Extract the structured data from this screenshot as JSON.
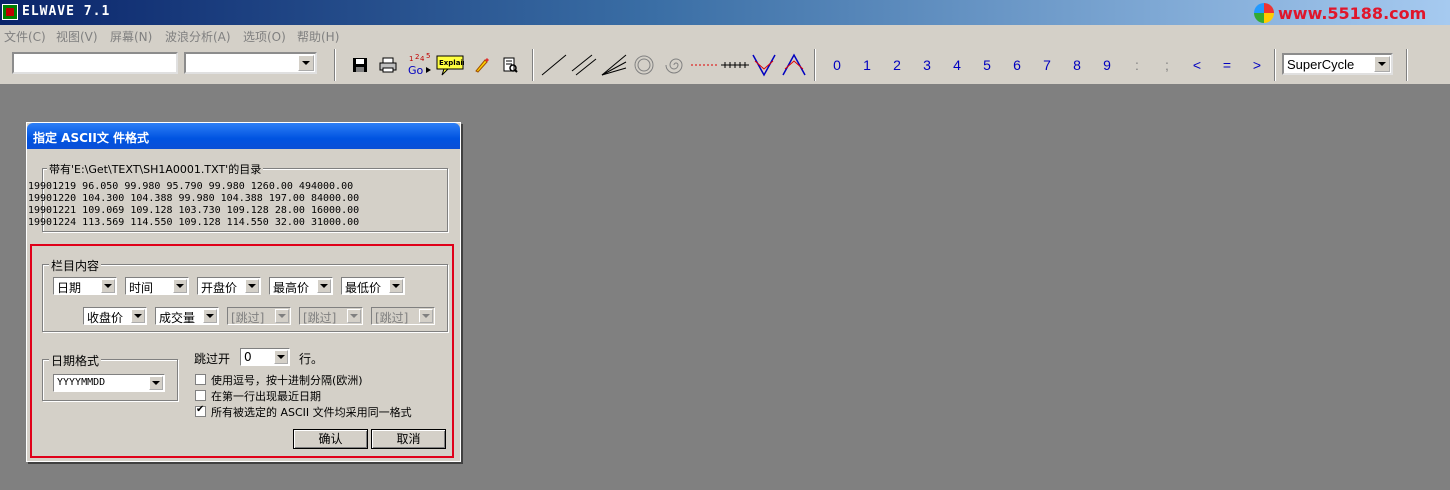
{
  "app": {
    "title": "ELWAVE 7.1",
    "watermark": "www.55188.com"
  },
  "menu": [
    {
      "label": "文件(C)"
    },
    {
      "label": "视图(V)"
    },
    {
      "label": "屏幕(N)"
    },
    {
      "label": "波浪分析(A)"
    },
    {
      "label": "选项(O)"
    },
    {
      "label": "帮助(H)"
    }
  ],
  "toolbar": {
    "symbol_input_value": "",
    "period_select_value": "",
    "explain_label": "Explain",
    "goto_label": "Go",
    "number_buttons": [
      "0",
      "1",
      "2",
      "3",
      "4",
      "5",
      "6",
      "7",
      "8",
      "9",
      ":",
      ";",
      "<",
      "=",
      ">"
    ],
    "degree_select_value": "SuperCycle"
  },
  "dialog": {
    "title": "指定 ASCII文 件格式",
    "preview_group_label": "带有'E:\\Get\\TEXT\\SH1A0001.TXT'的目录",
    "preview_lines": [
      "19901219 96.050 99.980 95.790 99.980 1260.00 494000.00",
      "19901220 104.300 104.388 99.980 104.388 197.00 84000.00",
      "19901221 109.069 109.128 103.730 109.128 28.00 16000.00",
      "19901224 113.569 114.550 109.128 114.550 32.00 31000.00"
    ],
    "columns_group_label": "栏目内容",
    "columns_row1": [
      "日期",
      "时间",
      "开盘价",
      "最高价",
      "最低价"
    ],
    "columns_row2": [
      "收盘价",
      "成交量",
      "[跳过]",
      "[跳过]",
      "[跳过]"
    ],
    "date_format_group_label": "日期格式",
    "date_format_value": "YYYYMMDD",
    "skip_prefix": "跳过开",
    "skip_value": "0",
    "skip_suffix": "行。",
    "options": [
      {
        "label": "使用逗号，按十进制分隔(欧洲)",
        "checked": false
      },
      {
        "label": "在第一行出现最近日期",
        "checked": false
      },
      {
        "label": "所有被选定的 ASCII 文件均采用同一格式",
        "checked": true
      }
    ],
    "ok_label": "确认",
    "cancel_label": "取消"
  },
  "colors": {
    "highlight_border": "#e0001a",
    "number_button_text": "#0000c0",
    "desktop": "#808080"
  }
}
